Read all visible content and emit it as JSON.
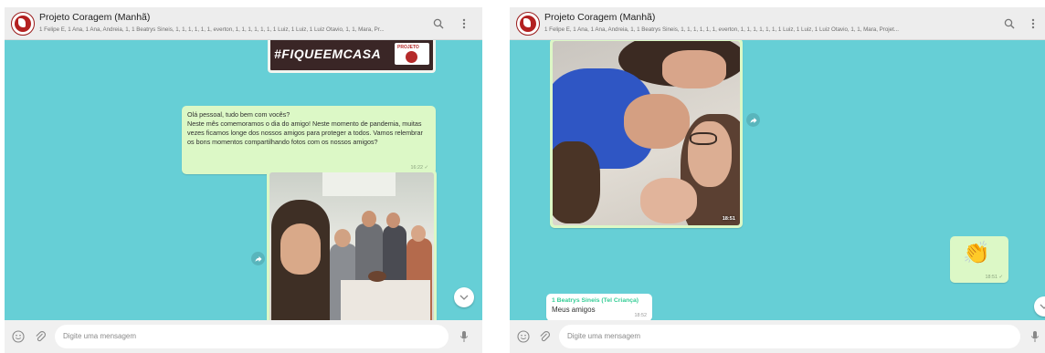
{
  "left": {
    "header": {
      "title": "Projeto Coragem (Manhã)",
      "participants": "1 Felipe E, 1 Ana, 1 Ana, Andreia, 1, 1 Beatrys Sineis, 1, 1, 1, 1, 1, 1, everton, 1, 1, 1, 1, 1, 1, 1 Luiz, 1 Luiz, 1 Luiz Otavio, 1, 1, Mara, Pr..."
    },
    "banner": {
      "text": "#FIQUEEMCASA",
      "stamp_text": "PROJETO"
    },
    "message": {
      "text": "Olá pessoal, tudo bem com vocês?\nNeste mês comemoramos o dia do amigo! Neste momento de pandemia, muitas vezes ficamos longe dos nossos amigos para proteger a todos. Vamos relembrar os bons momentos compartilhando fotos com os nossos amigos?",
      "time": "16:22"
    },
    "footer": {
      "placeholder": "Digite uma mensagem"
    }
  },
  "right": {
    "header": {
      "title": "Projeto Coragem (Manhã)",
      "participants": "1 Felipe E, 1 Ana, 1 Ana, Andreia, 1, 1 Beatrys Sineis, 1, 1, 1, 1, 1, 1, everton, 1, 1, 1, 1, 1, 1, 1 Luiz, 1 Luiz, 1 Luiz Otavio, 1, 1, Mara, Projet..."
    },
    "photo": {
      "time": "18:51"
    },
    "sticker_message": {
      "emoji": "👏",
      "time": "18:51"
    },
    "incoming": {
      "sender": "1 Beatrys Sineis (Tel Criança)",
      "text": "Meus amigos",
      "time": "18:52"
    },
    "footer": {
      "placeholder": "Digite uma mensagem"
    }
  },
  "colors": {
    "chat_bg": "#66cfd6",
    "outgoing": "#dcf8c6",
    "sender_name": "#35cd96",
    "header_bg": "#ededed"
  },
  "icons": [
    "avatar-logo",
    "search-icon",
    "menu-icon",
    "emoji-icon",
    "attach-icon",
    "mic-icon",
    "forward-icon",
    "chevron-down-icon",
    "double-check-icon"
  ]
}
